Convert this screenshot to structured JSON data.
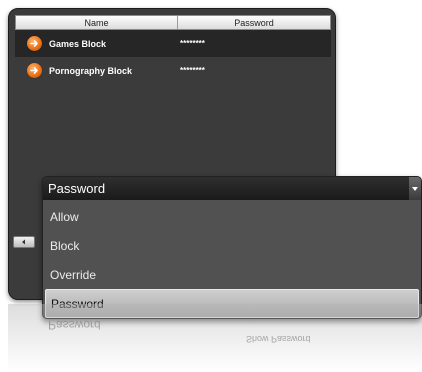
{
  "grid": {
    "columns": {
      "name": "Name",
      "password": "Password"
    },
    "rows": [
      {
        "name": "Games Block",
        "password": "********",
        "icon": "arrow-right-icon",
        "selected": true
      },
      {
        "name": "Pornography Block",
        "password": "********",
        "icon": "arrow-right-icon",
        "selected": false
      }
    ]
  },
  "dropdown": {
    "selected_value": "Password",
    "options": [
      "Allow",
      "Block",
      "Override",
      "Password"
    ],
    "highlighted_option": "Password"
  },
  "reflection": {
    "field_text": "Password",
    "checkbox_text": "Show Password"
  },
  "colors": {
    "panel_bg": "#3b3b3b",
    "selected_row": "#262626",
    "accent_orange": "#e86f12",
    "dropdown_bg": "#515151"
  }
}
